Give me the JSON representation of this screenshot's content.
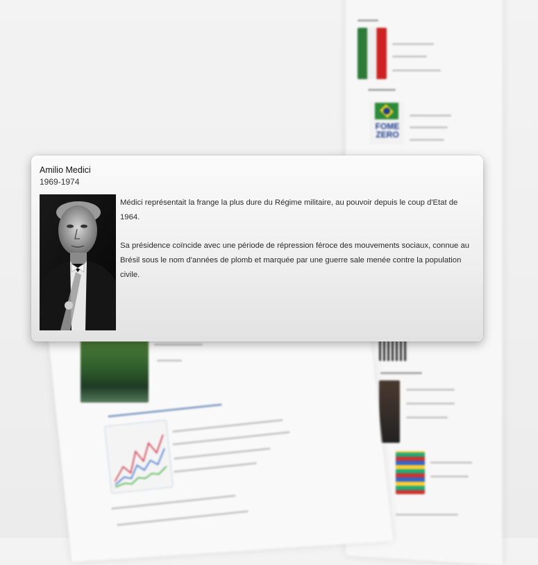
{
  "popup": {
    "name": "Amilio Medici",
    "years": "1969-1974",
    "paragraphs": [
      "Médici représentait la frange la plus dure du Régime militaire, au pouvoir depuis le coup d'Etat de 1964.",
      "Sa présidence coïncide avec une période de répression féroce des mouvements sociaux, connue au Brésil sous le nom d'années de plomb et marquée par une guerre sale menée contre la population civile."
    ],
    "portrait": "portrait-photo"
  },
  "background": {
    "right_column_images": [
      "mexico-flag-thumbnail",
      "fome-zero-logo-thumbnail",
      "chart-thumbnail",
      "portrait-thumbnail",
      "flags-grid-thumbnail"
    ],
    "left_column_images": [
      "forest-river-thumbnail",
      "line-chart-thumbnail"
    ],
    "fome_zero_text": "FOME ZERO"
  }
}
